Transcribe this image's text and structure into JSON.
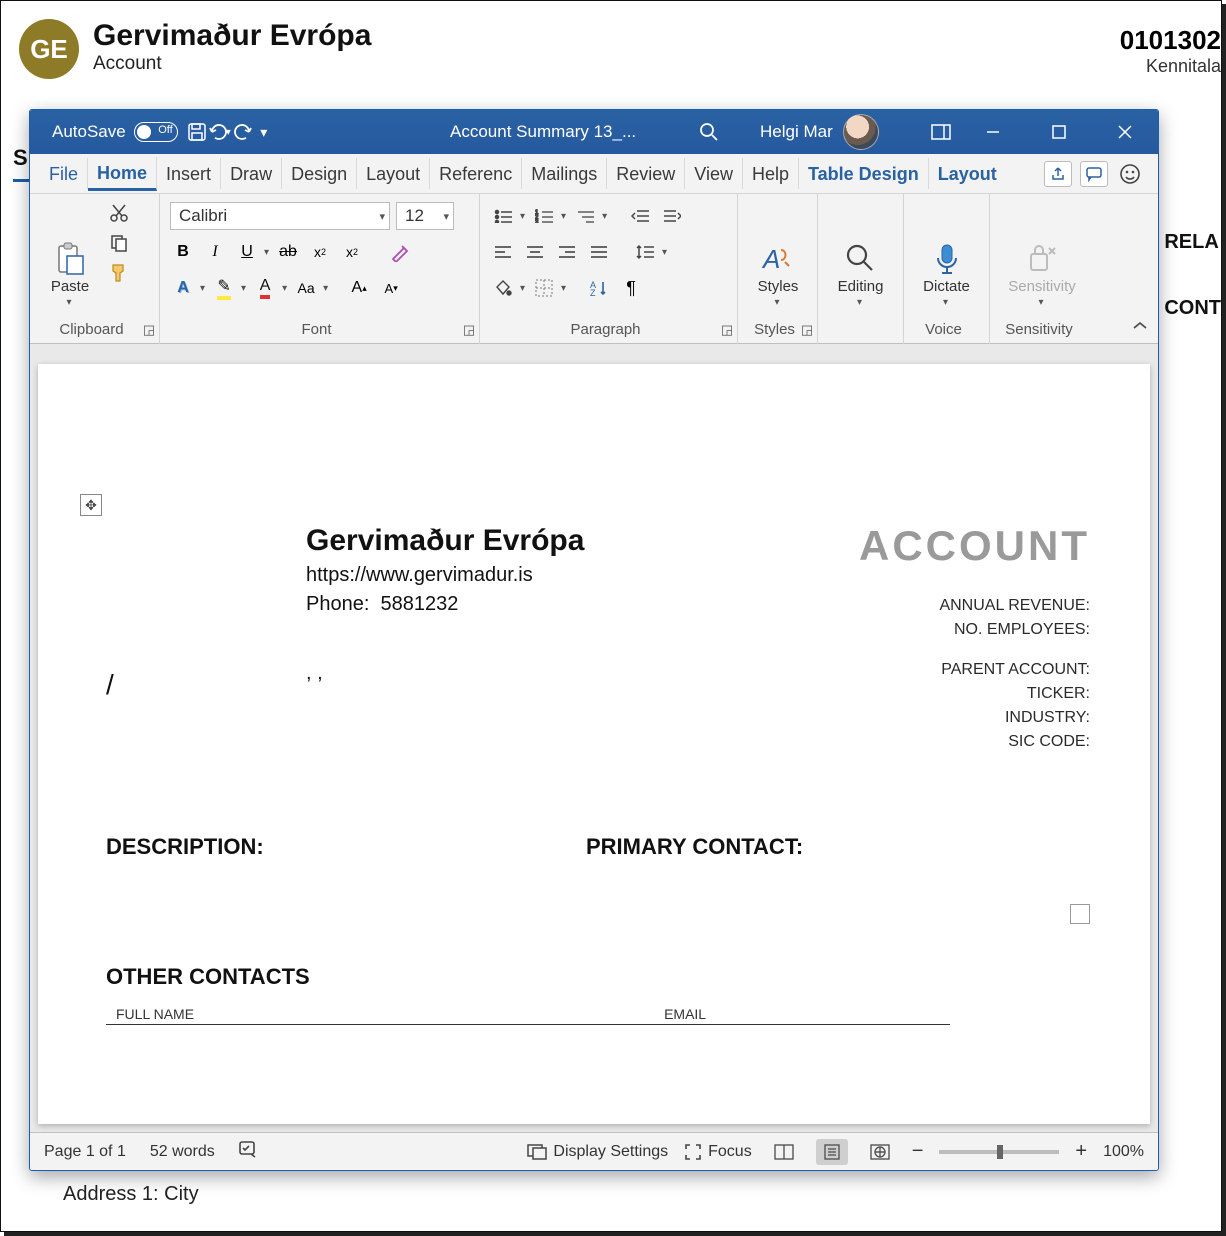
{
  "crm": {
    "avatar_initials": "GE",
    "title": "Gervimaður Evrópa",
    "subtitle": "Account",
    "id_partial": "0101302",
    "id_label_partial": "Kennitala",
    "left_cut": "S",
    "right_cut_1": "RELA",
    "right_cut_2": "CONT",
    "address_label": "Address 1: City"
  },
  "titlebar": {
    "autosave": "AutoSave",
    "autosave_state": "Off",
    "doc_title": "Account Summary 13_...",
    "user": "Helgi Mar"
  },
  "tabs": {
    "file": "File",
    "home": "Home",
    "insert": "Insert",
    "draw": "Draw",
    "design": "Design",
    "layout": "Layout",
    "references": "Referenc",
    "mailings": "Mailings",
    "review": "Review",
    "view": "View",
    "help": "Help",
    "table_design": "Table Design",
    "table_layout": "Layout"
  },
  "ribbon": {
    "clipboard": {
      "title": "Clipboard",
      "paste": "Paste"
    },
    "font": {
      "title": "Font",
      "family": "Calibri",
      "size": "12"
    },
    "paragraph": {
      "title": "Paragraph"
    },
    "styles": {
      "title": "Styles",
      "label": "Styles"
    },
    "editing": {
      "title": "",
      "label": "Editing"
    },
    "voice": {
      "title": "Voice",
      "label": "Dictate"
    },
    "sensitivity": {
      "title": "Sensitivity",
      "label": "Sensitivity"
    }
  },
  "doc": {
    "name": "Gervimaður Evrópa",
    "url": "https://www.gervimadur.is",
    "phone_label": "Phone:",
    "phone_value": "5881232",
    "commas": ", ,",
    "slash": "/",
    "account_big": "ACCOUNT",
    "labels": {
      "annual_revenue": "ANNUAL REVENUE:",
      "no_employees": "NO. EMPLOYEES:",
      "parent_account": "PARENT ACCOUNT:",
      "ticker": "TICKER:",
      "industry": "INDUSTRY:",
      "sic": "SIC CODE:"
    },
    "sections": {
      "description": "DESCRIPTION:",
      "primary_contact": "PRIMARY CONTACT:",
      "other_contacts": "OTHER CONTACTS"
    },
    "columns": {
      "full_name": "FULL NAME",
      "email": "EMAIL"
    }
  },
  "status": {
    "page": "Page 1 of 1",
    "words": "52 words",
    "display_settings": "Display Settings",
    "focus": "Focus",
    "zoom": "100%"
  }
}
